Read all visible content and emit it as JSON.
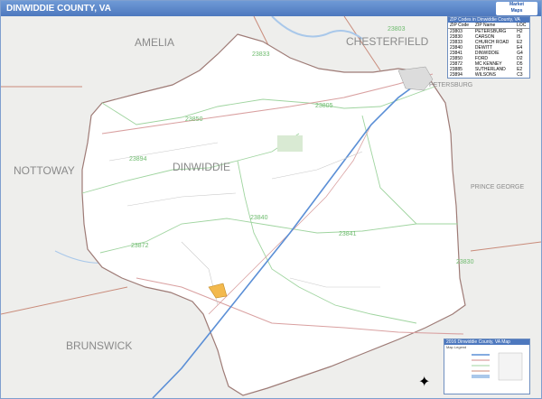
{
  "header": {
    "title": "DINWIDDIE COUNTY, VA",
    "brand_top": "Market",
    "brand_bottom": "Maps"
  },
  "map_labels": {
    "amelia": "AMELIA",
    "chesterfield": "CHESTERFIELD",
    "nottoway": "NOTTOWAY",
    "dinwiddie": "DINWIDDIE",
    "prince_george": "PRINCE GEORGE",
    "brunswick": "BRUNSWICK",
    "petersburg": "PETERSBURG"
  },
  "zip_labels": {
    "z23833_n": "23833",
    "z23803": "23803",
    "z23850": "23850",
    "z23805": "23805",
    "z23894": "23894",
    "z23840": "23840",
    "z23841": "23841",
    "z23872": "23872",
    "z23830": "23830"
  },
  "legend": {
    "heading": "ZIP Codes in Dinwiddie County, VA",
    "columns": [
      "ZIP Code",
      "ZIP Name",
      "LOC"
    ],
    "rows": [
      [
        "23803",
        "PETERSBURG",
        "H2"
      ],
      [
        "23830",
        "CARSON",
        "I5"
      ],
      [
        "23833",
        "CHURCH ROAD",
        "E2"
      ],
      [
        "23840",
        "DEWITT",
        "E4"
      ],
      [
        "23841",
        "DINWIDDIE",
        "G4"
      ],
      [
        "23850",
        "FORD",
        "D2"
      ],
      [
        "23872",
        "MC KENNEY",
        "D5"
      ],
      [
        "23885",
        "SUTHERLAND",
        "E2"
      ],
      [
        "23894",
        "WILSONS",
        "C3"
      ]
    ]
  },
  "scale_box": {
    "heading": "2016 Dinwiddie County, VA Map",
    "subheading": "Map Legend"
  },
  "colors": {
    "title_bar": "#4d78be",
    "county_fill": "#ffffff",
    "outside_fill": "#eeeeec",
    "zip_boundary": "#9fd49f",
    "county_line": "#c98b7a",
    "interstate": "#5b8fd6",
    "highway": "#d9a0a0",
    "water": "#a9c8ea"
  }
}
